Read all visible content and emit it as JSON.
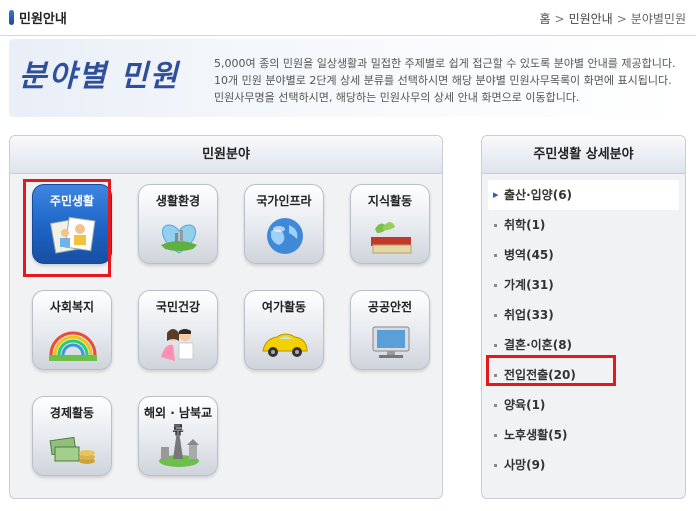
{
  "header": {
    "title": "민원안내"
  },
  "breadcrumb": {
    "home": "홈",
    "section": "민원안내",
    "current": "분야별민원"
  },
  "banner": {
    "logo_text": "분야별 민원",
    "lines": [
      "5,000여 종의 민원을 일상생활과 밀접한 주제별로 쉽게 접근할 수 있도록 분야별 안내를 제공합니다.",
      "10개 민원 분야별로 2단계 상세 분류를 선택하시면 해당 분야별 민원사무목록이 화면에 표시됩니다.",
      "민원사무명을 선택하시면, 해당하는 민원사무의 상세 안내 화면으로 이동합니다."
    ]
  },
  "left_panel": {
    "title": "민원분야",
    "categories": [
      {
        "label": "주민생활",
        "icon": "family-photo-icon"
      },
      {
        "label": "생활환경",
        "icon": "heart-landscape-icon"
      },
      {
        "label": "국가인프라",
        "icon": "globe-icon"
      },
      {
        "label": "지식활동",
        "icon": "book-icon"
      },
      {
        "label": "사회복지",
        "icon": "rainbow-icon"
      },
      {
        "label": "국민건강",
        "icon": "couple-icon"
      },
      {
        "label": "여가활동",
        "icon": "car-icon"
      },
      {
        "label": "공공안전",
        "icon": "monitor-icon"
      },
      {
        "label": "경제활동",
        "icon": "money-icon"
      },
      {
        "label": "해외 · 남북교류",
        "icon": "landmark-globe-icon"
      }
    ],
    "selected": "주민생활"
  },
  "right_panel": {
    "title": "주민생활  상세분야",
    "items": [
      "출산·입양(6)",
      "취학(1)",
      "병역(45)",
      "가계(31)",
      "취업(33)",
      "결혼·이혼(8)",
      "전입전출(20)",
      "양육(1)",
      "노후생활(5)",
      "사망(9)"
    ],
    "selected": "출산·입양(6)",
    "highlighted": "전입전출(20)"
  },
  "colors": {
    "accent": "#1d63c6",
    "highlight": "#e5191d"
  }
}
